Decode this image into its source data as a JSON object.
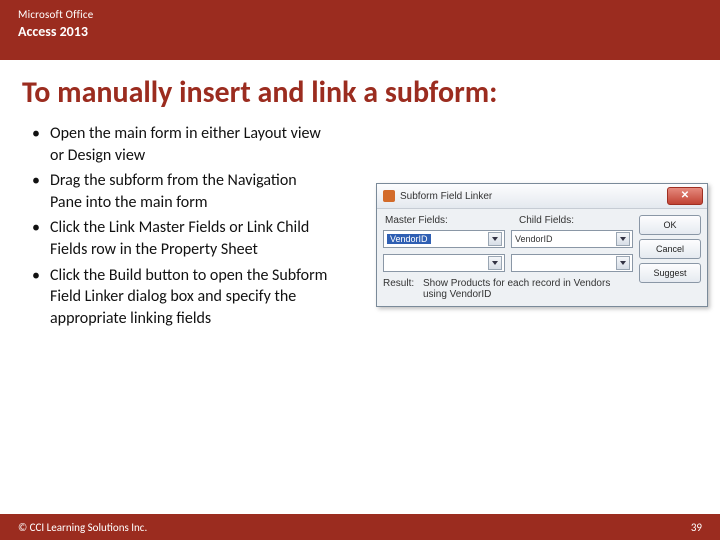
{
  "header": {
    "line1": "Microsoft Office",
    "line2": "Access 2013"
  },
  "title": "To manually insert and link a subform:",
  "bullets": [
    "Open the main form in either Layout view or Design view",
    "Drag the subform from the Navigation Pane into the main form",
    "Click the Link Master Fields or Link Child Fields row in the Property Sheet",
    "Click the Build button to open the Subform Field Linker dialog box and specify the appropriate linking fields"
  ],
  "dialog": {
    "title": "Subform Field Linker",
    "master_header": "Master Fields:",
    "child_header": "Child Fields:",
    "master_value": "VendorID",
    "child_value": "VendorID",
    "result_label": "Result:",
    "result_value": "Show Products for each record in Vendors using VendorID",
    "buttons": {
      "ok": "OK",
      "cancel": "Cancel",
      "suggest": "Suggest"
    },
    "close_glyph": "✕"
  },
  "footer": {
    "copyright": "© CCI Learning Solutions Inc.",
    "page": "39"
  }
}
